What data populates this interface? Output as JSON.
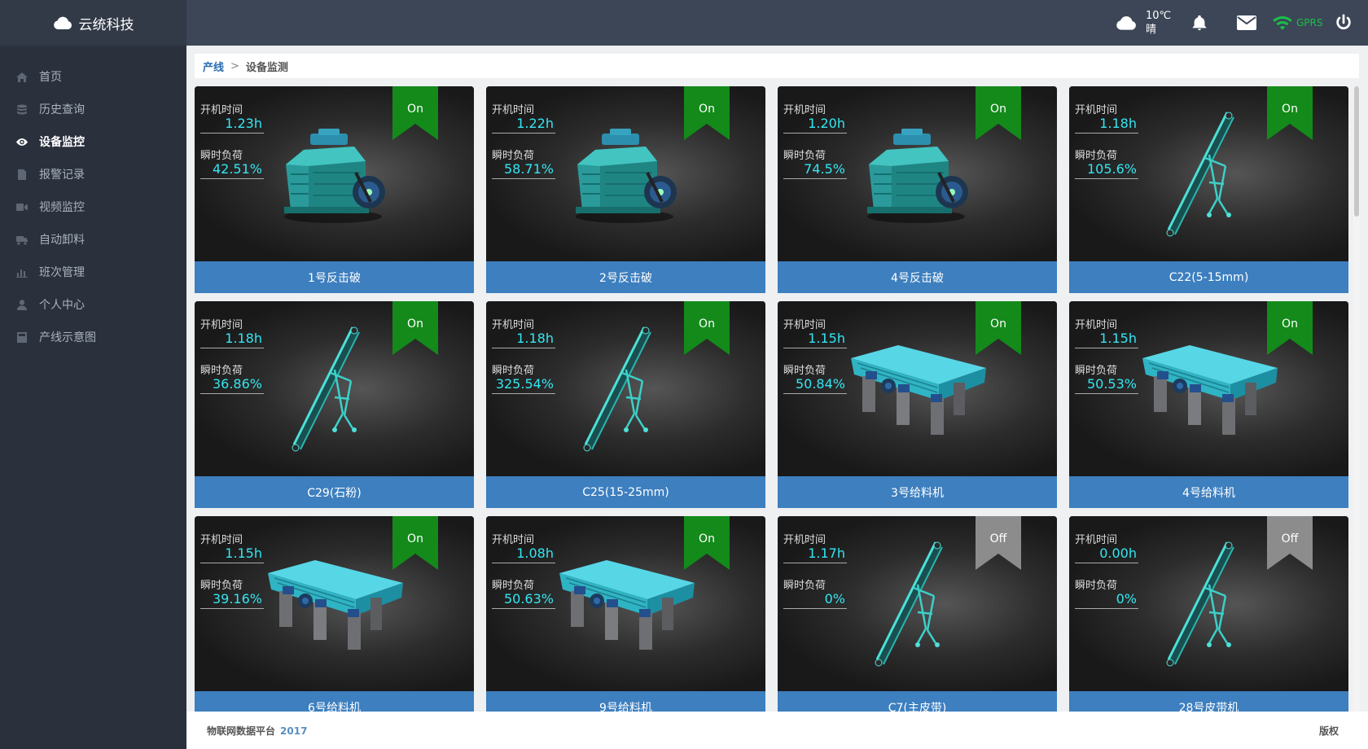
{
  "app": {
    "brand": "云统科技"
  },
  "sidebar": {
    "items": [
      {
        "label": "首页",
        "icon": "home-icon"
      },
      {
        "label": "历史查询",
        "icon": "database-icon"
      },
      {
        "label": "设备监控",
        "icon": "eye-icon",
        "active": true
      },
      {
        "label": "报警记录",
        "icon": "document-icon"
      },
      {
        "label": "视频监控",
        "icon": "video-icon"
      },
      {
        "label": "自动卸料",
        "icon": "truck-icon"
      },
      {
        "label": "班次管理",
        "icon": "bar-chart-icon"
      },
      {
        "label": "个人中心",
        "icon": "user-icon"
      },
      {
        "label": "产线示意图",
        "icon": "calculator-icon"
      }
    ]
  },
  "topbar": {
    "temperature": "10℃",
    "weather": "晴",
    "signal": "GPRS"
  },
  "breadcrumb": {
    "parent": "产线",
    "current": "设备监测"
  },
  "labels": {
    "runtime": "开机时间",
    "load": "瞬时负荷"
  },
  "devices": [
    {
      "name": "1号反击破",
      "runtime": "1.23h",
      "load": "42.51%",
      "status": "On",
      "kind": "crusher"
    },
    {
      "name": "2号反击破",
      "runtime": "1.22h",
      "load": "58.71%",
      "status": "On",
      "kind": "crusher"
    },
    {
      "name": "4号反击破",
      "runtime": "1.20h",
      "load": "74.5%",
      "status": "On",
      "kind": "crusher"
    },
    {
      "name": "C22(5-15mm)",
      "runtime": "1.18h",
      "load": "105.6%",
      "status": "On",
      "kind": "conveyor"
    },
    {
      "name": "C29(石粉)",
      "runtime": "1.18h",
      "load": "36.86%",
      "status": "On",
      "kind": "conveyor"
    },
    {
      "name": "C25(15-25mm)",
      "runtime": "1.18h",
      "load": "325.54%",
      "status": "On",
      "kind": "conveyor"
    },
    {
      "name": "3号给料机",
      "runtime": "1.15h",
      "load": "50.84%",
      "status": "On",
      "kind": "feeder"
    },
    {
      "name": "4号给料机",
      "runtime": "1.15h",
      "load": "50.53%",
      "status": "On",
      "kind": "feeder"
    },
    {
      "name": "6号给料机",
      "runtime": "1.15h",
      "load": "39.16%",
      "status": "On",
      "kind": "feeder"
    },
    {
      "name": "9号给料机",
      "runtime": "1.08h",
      "load": "50.63%",
      "status": "On",
      "kind": "feeder"
    },
    {
      "name": "C7(主皮带)",
      "runtime": "1.17h",
      "load": "0%",
      "status": "Off",
      "kind": "conveyor"
    },
    {
      "name": "28号皮带机",
      "runtime": "0.00h",
      "load": "0%",
      "status": "Off",
      "kind": "conveyor"
    }
  ],
  "colors": {
    "on": "#138a1a",
    "off": "#8c8c8c",
    "value": "#34e6f2",
    "nameBar": "#3d7fbf"
  },
  "footer": {
    "title": "物联网数据平台",
    "year": "2017",
    "copyright": "版权"
  }
}
